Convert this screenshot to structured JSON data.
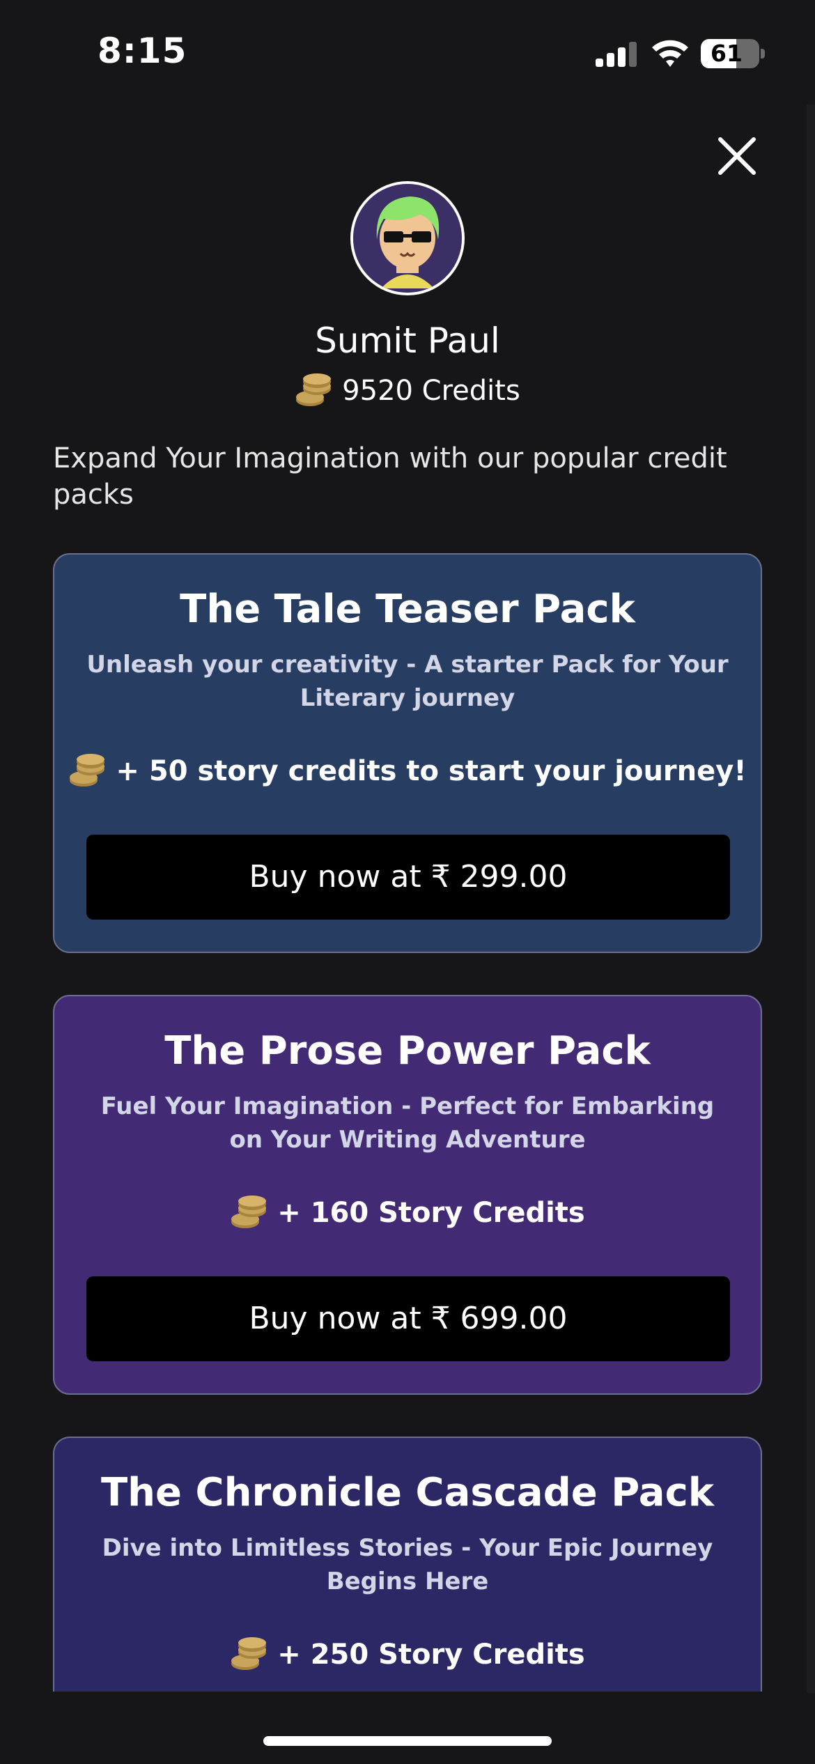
{
  "status_bar": {
    "time": "8:15",
    "battery_level": "61",
    "battery_percent": 61,
    "icons": [
      "cellular-signal-icon",
      "wifi-icon",
      "battery-icon"
    ]
  },
  "close_icon": "close-icon",
  "profile": {
    "name": "Sumit Paul",
    "credits": "9520 Credits",
    "avatar_icon": "avatar-icon"
  },
  "intro_text": "Expand Your Imagination with our popular credit packs",
  "packs": [
    {
      "title": "The Tale Teaser Pack",
      "description": "Unleash your creativity - A starter Pack for Your Literary journey",
      "credits": "+ 50 story credits to start your journey!",
      "button": "Buy now at ₹ 299.00",
      "color": "#273d62"
    },
    {
      "title": "The Prose Power Pack",
      "description": "Fuel Your Imagination - Perfect for Embarking on Your Writing Adventure",
      "credits": "+ 160 Story Credits",
      "button": "Buy now at ₹ 699.00",
      "color": "#432a74"
    },
    {
      "title": "The Chronicle Cascade Pack",
      "description": "Dive into Limitless Stories - Your Epic Journey Begins Here",
      "credits": "+ 250 Story Credits",
      "color": "#2c2866"
    }
  ],
  "coin_icon": "coins-icon",
  "coin_color": "#c9a55c"
}
